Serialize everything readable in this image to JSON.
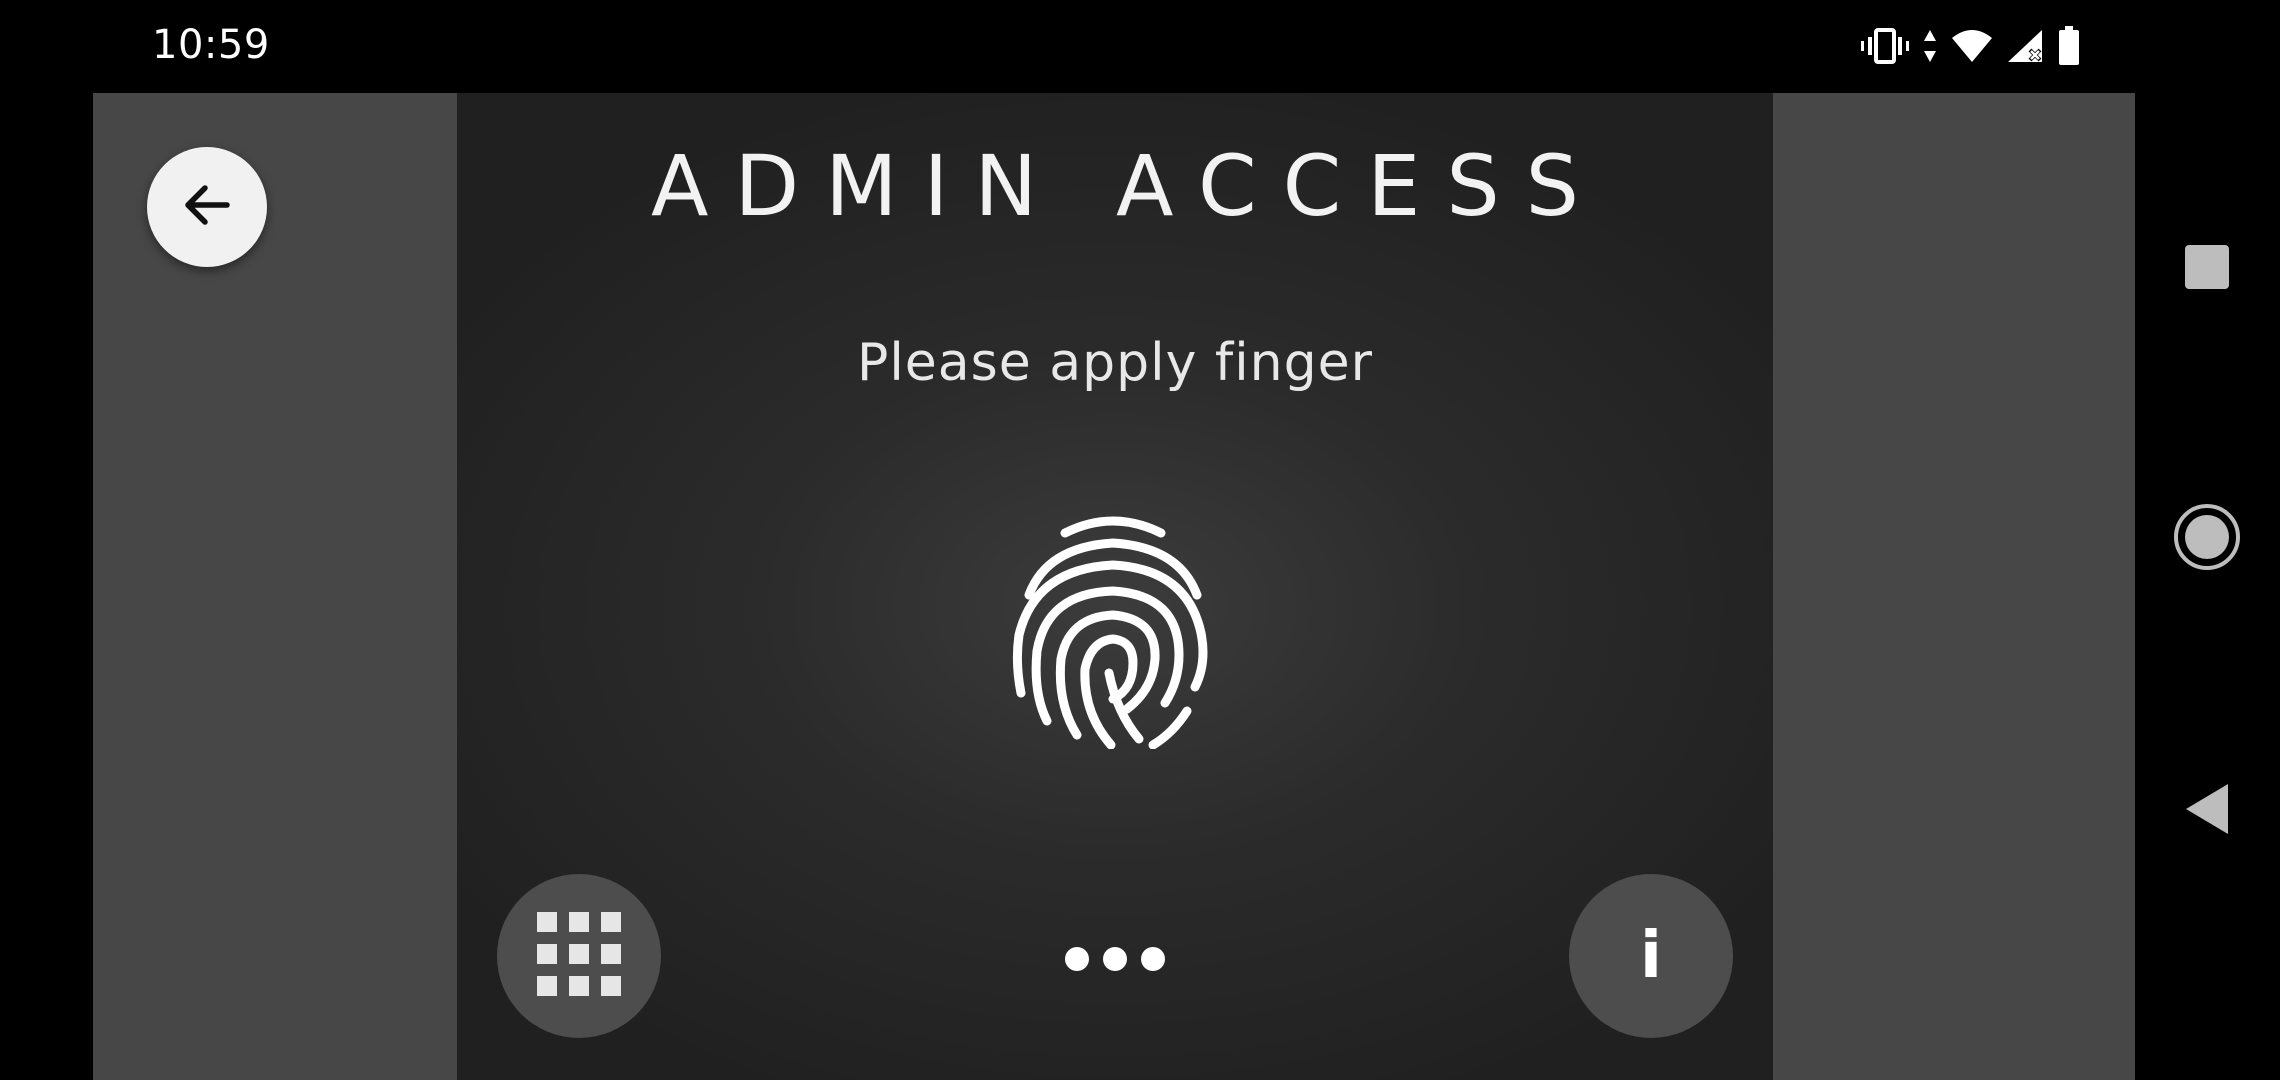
{
  "status_bar": {
    "time": "10:59",
    "icons": [
      "vibrate-icon",
      "data-arrows-icon",
      "wifi-icon",
      "signal-no-service-icon",
      "battery-icon"
    ]
  },
  "app": {
    "back_button_icon": "arrow-left-icon"
  },
  "device_screen": {
    "title": "ADMIN ACCESS",
    "prompt": "Please apply finger",
    "center_icon": "fingerprint-icon",
    "keypad_button_icon": "keypad-grid-icon",
    "dots_indicator": "•••",
    "info_button_label": "i"
  },
  "nav_bar": {
    "buttons": [
      "recents-square-icon",
      "home-circle-icon",
      "back-triangle-icon"
    ]
  },
  "colors": {
    "page_background": "#000000",
    "app_background": "#474747",
    "screen_background": "#2b2b2b",
    "round_button": "#4d4d4d",
    "back_button": "#f1f1f1",
    "text": "#f2f2f2"
  }
}
